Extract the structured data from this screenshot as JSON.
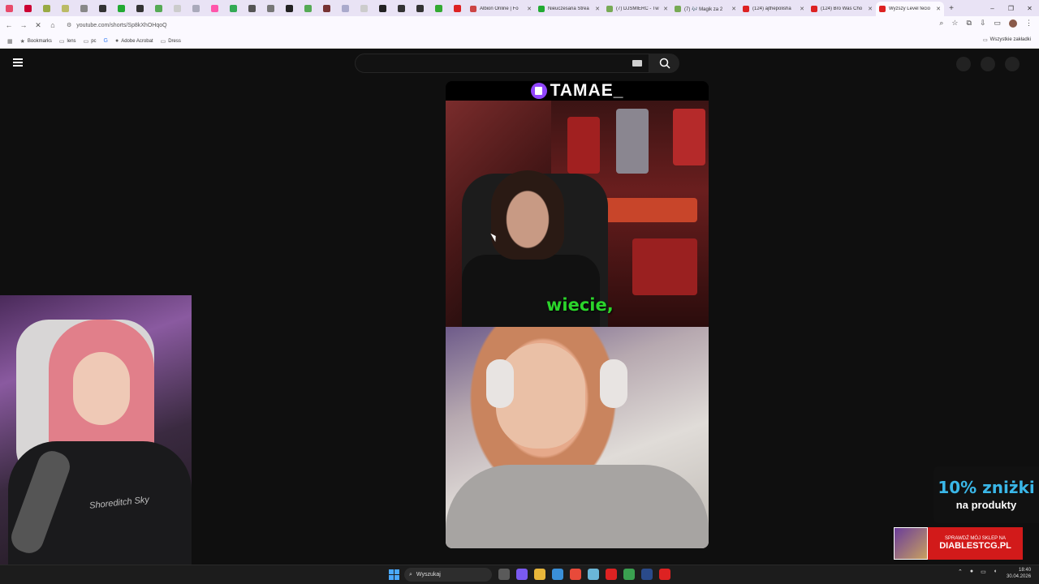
{
  "browser": {
    "tabs_mini_colors": [
      "#e84a6a",
      "#c03",
      "#9a4",
      "#bb6",
      "#888",
      "#333",
      "#2a3",
      "#333",
      "#5a5",
      "#ccc",
      "#aab",
      "#f5a",
      "#3a5",
      "#555",
      "#777",
      "#222",
      "#5a5",
      "#733",
      "#aac",
      "#ccc",
      "#222",
      "#333",
      "#333",
      "#3a3",
      "#d22"
    ],
    "tabs": [
      {
        "title": "Albion Online | Fo",
        "color": "#c44"
      },
      {
        "title": "Nieuczesana Strea",
        "color": "#2a3"
      },
      {
        "title": "(7) DJSMIERC - Tw",
        "color": "#7a5"
      },
      {
        "title": "(7) 🎶 Magik za 2",
        "color": "#7a5"
      },
      {
        "title": "(124) ajthepolisha",
        "color": "#d22"
      },
      {
        "title": "(124) Bro Was Cho",
        "color": "#d22"
      },
      {
        "title": "Wyższy Level fecio",
        "color": "#d22",
        "active": true
      }
    ],
    "url": "youtube.com/shorts/Sp8kXhOHqoQ",
    "bookmarks": [
      "Bookmarks",
      "lens",
      "pc",
      "",
      "Adobe Acrobat",
      "Dress"
    ],
    "bookmarks_right": "Wszystkie zakładki"
  },
  "youtube": {
    "channel_name": "TAMAE_",
    "subtitle": "wiecie,",
    "webcam_hoodie_text": "Shoreditch Sky"
  },
  "promo": {
    "discount": "10% zniżki",
    "discount_sub": "na produkty",
    "shop_line1": "SPRAWDŹ MÓJ SKLEP NA",
    "shop_line2": "DIABLESTCG.PL"
  },
  "taskbar": {
    "search_placeholder": "Wyszukaj",
    "time": "18:40",
    "date": "30.04.2026",
    "app_colors": [
      "#5a5a5a",
      "#7a5af0",
      "#e8b63a",
      "#3a8fd8",
      "#e84a3a",
      "#6ab6d8",
      "#d22",
      "#3aa050",
      "#2a4a8a",
      "#d22"
    ]
  }
}
